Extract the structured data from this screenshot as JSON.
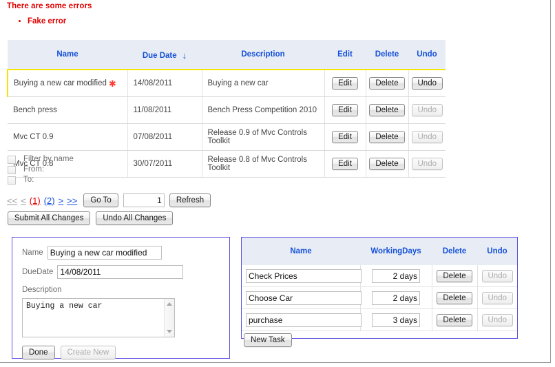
{
  "errors": {
    "title": "There are some errors",
    "items": [
      "Fake error"
    ]
  },
  "grid": {
    "columns": [
      "Name",
      "Due Date",
      "Description",
      "Edit",
      "Delete",
      "Undo"
    ],
    "sort_indicator": "↓",
    "dirty_marker": "✱",
    "rows": [
      {
        "name": "Buying a new car modified",
        "dirty": true,
        "due_date": "14/08/2011",
        "description": "Buying a new car",
        "edit_label": "Edit",
        "delete_label": "Delete",
        "undo_label": "Undo",
        "undo_enabled": true,
        "highlighted": true
      },
      {
        "name": "Bench press",
        "dirty": false,
        "due_date": "11/08/2011",
        "description": "Bench Press Competition 2010",
        "edit_label": "Edit",
        "delete_label": "Delete",
        "undo_label": "Undo",
        "undo_enabled": false,
        "highlighted": false
      },
      {
        "name": "Mvc CT 0.9",
        "dirty": false,
        "due_date": "07/08/2011",
        "description": "Release  0.9 of Mvc Controls Toolkit",
        "edit_label": "Edit",
        "delete_label": "Delete",
        "undo_label": "Undo",
        "undo_enabled": false,
        "highlighted": false
      },
      {
        "name": "Mvc CT 0.8",
        "dirty": false,
        "due_date": "30/07/2011",
        "description": "Release  0.8 of Mvc Controls Toolkit",
        "edit_label": "Edit",
        "delete_label": "Delete",
        "undo_label": "Undo",
        "undo_enabled": false,
        "highlighted": false
      }
    ]
  },
  "filters": [
    {
      "label": "Filter by name",
      "checked": false
    },
    {
      "label": "From:",
      "checked": false
    },
    {
      "label": "To:",
      "checked": false
    }
  ],
  "pager": {
    "first": "<<",
    "prev": "<",
    "pages": [
      {
        "label": "(1)",
        "current": true
      },
      {
        "label": "(2)",
        "current": false
      }
    ],
    "next": ">",
    "last": ">>",
    "goto_label": "Go To",
    "goto_value": "1",
    "refresh_label": "Refresh"
  },
  "bulk": {
    "submit_label": "Submit All Changes",
    "undo_label": "Undo All Changes"
  },
  "edit_form": {
    "name_label": "Name",
    "name_value": "Buying a new car modified",
    "duedate_label": "DueDate",
    "duedate_value": "14/08/2011",
    "description_label": "Description",
    "description_value": "Buying a new car",
    "done_label": "Done",
    "create_new_label": "Create New"
  },
  "tasks": {
    "columns": [
      "Name",
      "WorkingDays",
      "Delete",
      "Undo"
    ],
    "rows": [
      {
        "name": "Check Prices",
        "working_days": "2 days",
        "delete_label": "Delete",
        "undo_label": "Undo",
        "undo_enabled": false
      },
      {
        "name": "Choose Car",
        "working_days": "2 days",
        "delete_label": "Delete",
        "undo_label": "Undo",
        "undo_enabled": false
      },
      {
        "name": "purchase",
        "working_days": "3 days",
        "delete_label": "Delete",
        "undo_label": "Undo",
        "undo_enabled": false
      }
    ],
    "new_task_label": "New Task"
  },
  "colors": {
    "error": "#e00000",
    "header_bg": "#e8edf5",
    "header_text": "#1550d8",
    "row_highlight": "#f5e500",
    "panel_border": "#5a50e0",
    "link": "#1550d8",
    "disabled": "#9a9a9a"
  }
}
